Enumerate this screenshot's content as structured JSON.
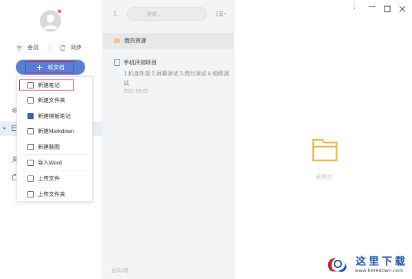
{
  "sidebar": {
    "member_label": "会员",
    "sync_label": "同步",
    "new_doc_label": "新文档"
  },
  "new_menu": {
    "items": [
      {
        "label": "新建笔记",
        "icon": "new-note-icon"
      },
      {
        "label": "新建文件夹",
        "icon": "new-folder-icon"
      },
      {
        "label": "新建模板笔记",
        "icon": "template-note-icon"
      },
      {
        "label": "新建Markdown",
        "icon": "markdown-icon"
      },
      {
        "label": "新建脑图",
        "icon": "mindmap-icon"
      },
      {
        "label": "导入Word",
        "icon": "import-word-icon"
      },
      {
        "label": "上传文件",
        "icon": "upload-file-icon"
      },
      {
        "label": "上传文件夹",
        "icon": "upload-folder-icon"
      }
    ]
  },
  "list": {
    "search_placeholder": "搜索...",
    "folder_header": "我的资源",
    "note": {
      "title": "手机评测项目",
      "desc": "1.机身外观 2.屏幕测试 3.跑分测试 4.拍照测试",
      "date": "2021-03-02"
    },
    "count_text": "总共2项"
  },
  "preview": {
    "empty_text": "无预览"
  },
  "watermark": {
    "text": "这里下载",
    "url": "www.heredown.com"
  },
  "colors": {
    "accent": "#5b7ed5",
    "highlight_box": "#d81f26",
    "folder": "#f3c77a"
  }
}
